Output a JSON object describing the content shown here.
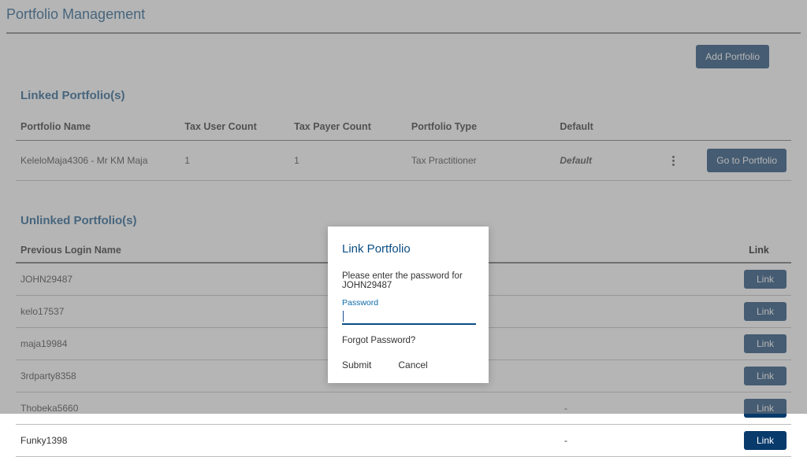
{
  "page": {
    "title": "Portfolio Management",
    "add_button": "Add Portfolio"
  },
  "linked": {
    "section_title": "Linked Portfolio(s)",
    "headers": {
      "name": "Portfolio Name",
      "tuc": "Tax User Count",
      "tpc": "Tax Payer Count",
      "type": "Portfolio Type",
      "def": "Default"
    },
    "rows": [
      {
        "name": "KeleloMaja4306 - Mr KM Maja",
        "tuc": "1",
        "tpc": "1",
        "type": "Tax Practitioner",
        "def": "Default",
        "go_label": "Go to Portfolio"
      }
    ]
  },
  "unlinked": {
    "section_title": "Unlinked Portfolio(s)",
    "headers": {
      "name": "Previous Login Name",
      "link": "Link"
    },
    "link_label": "Link",
    "rows": [
      {
        "name": "JOHN29487",
        "dash": ""
      },
      {
        "name": "kelo17537",
        "dash": ""
      },
      {
        "name": "maja19984",
        "dash": ""
      },
      {
        "name": "3rdparty8358",
        "dash": ""
      },
      {
        "name": "Thobeka5660",
        "dash": "-"
      },
      {
        "name": "Funky1398",
        "dash": "-"
      }
    ]
  },
  "modal": {
    "title": "Link Portfolio",
    "instruction": "Please enter the password for JOHN29487",
    "password_label": "Password",
    "password_value": "",
    "forgot": "Forgot Password?",
    "submit": "Submit",
    "cancel": "Cancel"
  }
}
